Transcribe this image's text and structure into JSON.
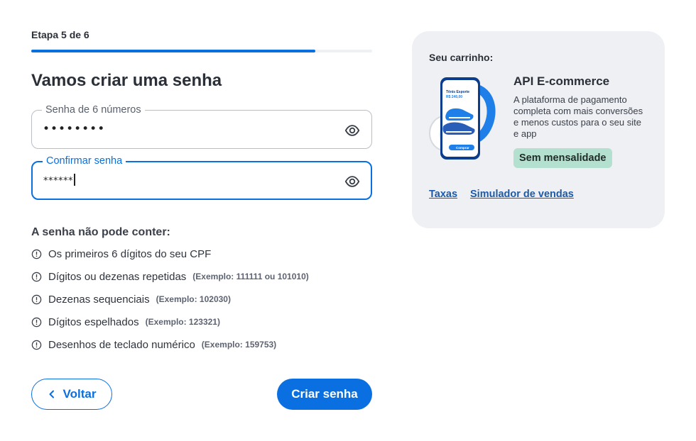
{
  "step": {
    "label": "Etapa 5 de 6",
    "current": 5,
    "total": 6
  },
  "title": "Vamos criar uma senha",
  "password_field": {
    "label": "Senha de 6 números",
    "value": "••••••••",
    "icon": "eye-icon"
  },
  "confirm_field": {
    "label": "Confirmar senha",
    "value": "******",
    "icon": "eye-icon"
  },
  "rules": {
    "title": "A senha não pode conter:",
    "items": [
      {
        "text": "Os primeiros 6 dígitos do seu CPF",
        "example": ""
      },
      {
        "text": "Dígitos ou dezenas repetidas",
        "example": "(Exemplo: 111111 ou 101010)"
      },
      {
        "text": "Dezenas sequenciais",
        "example": "(Exemplo: 102030)"
      },
      {
        "text": "Dígitos espelhados",
        "example": "(Exemplo: 123321)"
      },
      {
        "text": "Desenhos de teclado numérico",
        "example": "(Exemplo: 159753)"
      }
    ]
  },
  "buttons": {
    "back": "Voltar",
    "create": "Criar senha"
  },
  "cart": {
    "title": "Seu carrinho:",
    "product_name": "API E-commerce",
    "product_desc": "A plataforma de pagamento completa com mais conversões e menos custos para o seu site e app",
    "badge": "Sem mensalidade",
    "image_text": {
      "line1": "Tênis Esporte",
      "price": "R$ 240,00",
      "cta": "Comprar"
    },
    "links": {
      "fees": "Taxas",
      "simulator": "Simulador de vendas"
    }
  },
  "colors": {
    "primary": "#0a6fe0",
    "badge_bg": "#b3e0cf",
    "card_bg": "#eef0f3",
    "link": "#1d5aa8"
  }
}
